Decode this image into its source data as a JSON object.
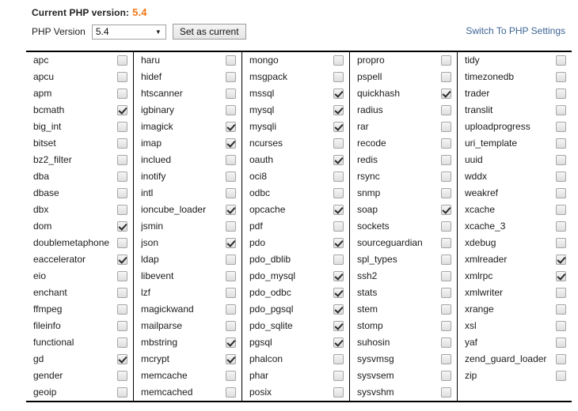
{
  "header": {
    "current_version_label": "Current PHP version:",
    "current_version_value": "5.4",
    "version_label": "PHP Version",
    "version_selected": "5.4",
    "dropdown_arrow": "▼",
    "set_as_current_label": "Set as current",
    "switch_link_label": "Switch To PHP Settings",
    "link_color": "#3d6394",
    "accent_color": "#f07818"
  },
  "extensions": {
    "columns": [
      [
        {
          "name": "apc",
          "checked": false
        },
        {
          "name": "apcu",
          "checked": false
        },
        {
          "name": "apm",
          "checked": false
        },
        {
          "name": "bcmath",
          "checked": true
        },
        {
          "name": "big_int",
          "checked": false
        },
        {
          "name": "bitset",
          "checked": false
        },
        {
          "name": "bz2_filter",
          "checked": false
        },
        {
          "name": "dba",
          "checked": false
        },
        {
          "name": "dbase",
          "checked": false
        },
        {
          "name": "dbx",
          "checked": false
        },
        {
          "name": "dom",
          "checked": true
        },
        {
          "name": "doublemetaphone",
          "checked": false
        },
        {
          "name": "eaccelerator",
          "checked": true
        },
        {
          "name": "eio",
          "checked": false
        },
        {
          "name": "enchant",
          "checked": false
        },
        {
          "name": "ffmpeg",
          "checked": false
        },
        {
          "name": "fileinfo",
          "checked": false
        },
        {
          "name": "functional",
          "checked": false
        },
        {
          "name": "gd",
          "checked": true
        },
        {
          "name": "gender",
          "checked": false
        },
        {
          "name": "geoip",
          "checked": false
        }
      ],
      [
        {
          "name": "haru",
          "checked": false
        },
        {
          "name": "hidef",
          "checked": false
        },
        {
          "name": "htscanner",
          "checked": false
        },
        {
          "name": "igbinary",
          "checked": false
        },
        {
          "name": "imagick",
          "checked": true
        },
        {
          "name": "imap",
          "checked": true
        },
        {
          "name": "inclued",
          "checked": false
        },
        {
          "name": "inotify",
          "checked": false
        },
        {
          "name": "intl",
          "checked": false
        },
        {
          "name": "ioncube_loader",
          "checked": true
        },
        {
          "name": "jsmin",
          "checked": false
        },
        {
          "name": "json",
          "checked": true
        },
        {
          "name": "ldap",
          "checked": false
        },
        {
          "name": "libevent",
          "checked": false
        },
        {
          "name": "lzf",
          "checked": false
        },
        {
          "name": "magickwand",
          "checked": false
        },
        {
          "name": "mailparse",
          "checked": false
        },
        {
          "name": "mbstring",
          "checked": true
        },
        {
          "name": "mcrypt",
          "checked": true
        },
        {
          "name": "memcache",
          "checked": false
        },
        {
          "name": "memcached",
          "checked": false
        }
      ],
      [
        {
          "name": "mongo",
          "checked": false
        },
        {
          "name": "msgpack",
          "checked": false
        },
        {
          "name": "mssql",
          "checked": true
        },
        {
          "name": "mysql",
          "checked": true
        },
        {
          "name": "mysqli",
          "checked": true
        },
        {
          "name": "ncurses",
          "checked": false
        },
        {
          "name": "oauth",
          "checked": true
        },
        {
          "name": "oci8",
          "checked": false
        },
        {
          "name": "odbc",
          "checked": false
        },
        {
          "name": "opcache",
          "checked": true
        },
        {
          "name": "pdf",
          "checked": false
        },
        {
          "name": "pdo",
          "checked": true
        },
        {
          "name": "pdo_dblib",
          "checked": false
        },
        {
          "name": "pdo_mysql",
          "checked": true
        },
        {
          "name": "pdo_odbc",
          "checked": true
        },
        {
          "name": "pdo_pgsql",
          "checked": true
        },
        {
          "name": "pdo_sqlite",
          "checked": true
        },
        {
          "name": "pgsql",
          "checked": true
        },
        {
          "name": "phalcon",
          "checked": false
        },
        {
          "name": "phar",
          "checked": false
        },
        {
          "name": "posix",
          "checked": false
        }
      ],
      [
        {
          "name": "propro",
          "checked": false
        },
        {
          "name": "pspell",
          "checked": false
        },
        {
          "name": "quickhash",
          "checked": true
        },
        {
          "name": "radius",
          "checked": false
        },
        {
          "name": "rar",
          "checked": false
        },
        {
          "name": "recode",
          "checked": false
        },
        {
          "name": "redis",
          "checked": false
        },
        {
          "name": "rsync",
          "checked": false
        },
        {
          "name": "snmp",
          "checked": false
        },
        {
          "name": "soap",
          "checked": true
        },
        {
          "name": "sockets",
          "checked": false
        },
        {
          "name": "sourceguardian",
          "checked": false
        },
        {
          "name": "spl_types",
          "checked": false
        },
        {
          "name": "ssh2",
          "checked": false
        },
        {
          "name": "stats",
          "checked": false
        },
        {
          "name": "stem",
          "checked": false
        },
        {
          "name": "stomp",
          "checked": false
        },
        {
          "name": "suhosin",
          "checked": false
        },
        {
          "name": "sysvmsg",
          "checked": false
        },
        {
          "name": "sysvsem",
          "checked": false
        },
        {
          "name": "sysvshm",
          "checked": false
        }
      ],
      [
        {
          "name": "tidy",
          "checked": false
        },
        {
          "name": "timezonedb",
          "checked": false
        },
        {
          "name": "trader",
          "checked": false
        },
        {
          "name": "translit",
          "checked": false
        },
        {
          "name": "uploadprogress",
          "checked": false
        },
        {
          "name": "uri_template",
          "checked": false
        },
        {
          "name": "uuid",
          "checked": false
        },
        {
          "name": "wddx",
          "checked": false
        },
        {
          "name": "weakref",
          "checked": false
        },
        {
          "name": "xcache",
          "checked": false
        },
        {
          "name": "xcache_3",
          "checked": false
        },
        {
          "name": "xdebug",
          "checked": false
        },
        {
          "name": "xmlreader",
          "checked": true
        },
        {
          "name": "xmlrpc",
          "checked": true
        },
        {
          "name": "xmlwriter",
          "checked": false
        },
        {
          "name": "xrange",
          "checked": false
        },
        {
          "name": "xsl",
          "checked": false
        },
        {
          "name": "yaf",
          "checked": false
        },
        {
          "name": "zend_guard_loader",
          "checked": false
        },
        {
          "name": "zip",
          "checked": false
        }
      ]
    ]
  }
}
